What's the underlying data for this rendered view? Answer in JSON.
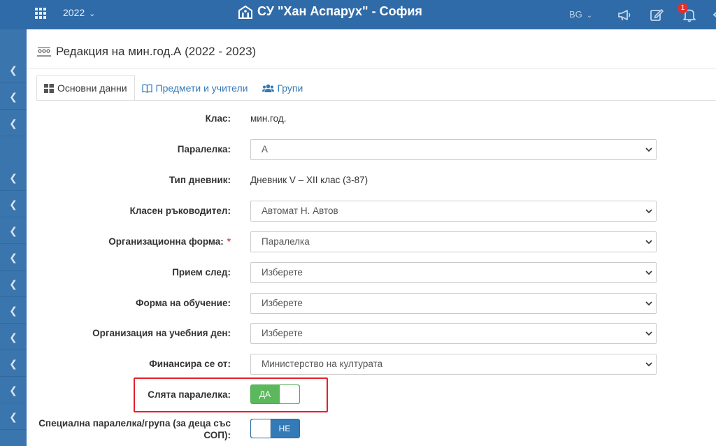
{
  "topbar": {
    "year": "2022",
    "school_name": "СУ \"Хан Аспарух\" - София",
    "language": "BG",
    "notifications_count": "1"
  },
  "page": {
    "title": "Редакция на мин.год.А (2022 - 2023)"
  },
  "tabs": [
    {
      "label": "Основни данни",
      "icon": "table-icon",
      "active": true
    },
    {
      "label": "Предмети и учители",
      "icon": "book-icon",
      "active": false
    },
    {
      "label": "Групи",
      "icon": "users-icon",
      "active": false
    }
  ],
  "form": {
    "class": {
      "label": "Клас:",
      "value": "мин.год."
    },
    "parallel": {
      "label": "Паралелка:",
      "value": "А"
    },
    "diary_type": {
      "label": "Тип дневник:",
      "value": "Дневник V – XII клас (3-87)"
    },
    "class_teacher": {
      "label": "Класен ръководител:",
      "value": "Автомат Н. Автов"
    },
    "org_form": {
      "label": "Организационна форма:",
      "required_mark": "*",
      "value": "Паралелка"
    },
    "admission_after": {
      "label": "Прием след:",
      "value": "Изберете"
    },
    "study_form": {
      "label": "Форма на обучение:",
      "value": "Изберете"
    },
    "school_day_org": {
      "label": "Организация на учебния ден:",
      "value": "Изберете"
    },
    "funded_by": {
      "label": "Финансира се от:",
      "value": "Министерство на културата"
    },
    "merged_class": {
      "label": "Слята паралелка:",
      "state": "ДА"
    },
    "special_class": {
      "label": "Специална паралелка/група (за деца със СОП):",
      "state": "НЕ"
    }
  },
  "colors": {
    "topbar": "#2f6ba8",
    "sidebar": "#3a75ae",
    "toggle_on": "#5cb85c",
    "toggle_off": "#337ab7",
    "highlight": "#e5202a",
    "link": "#337ab7"
  }
}
